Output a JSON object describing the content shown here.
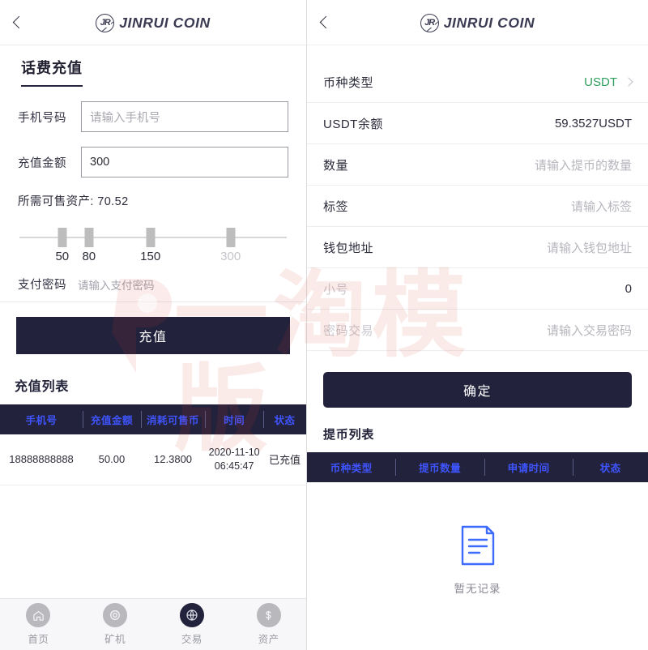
{
  "brand": {
    "logo_initials": "JR",
    "logo_text": "JINRUI COIN"
  },
  "watermark": {
    "text": "一淘模版"
  },
  "colors": {
    "primary_dark": "#23223c",
    "table_header_text": "#3e54ff",
    "accent_green": "#2f9e5f",
    "empty_icon": "#3d6bff"
  },
  "left_panel": {
    "back_icon": "chevron-left-icon",
    "tab_title": "话费充值",
    "fields": [
      {
        "label": "手机号码",
        "value": "",
        "placeholder": "请输入手机号"
      },
      {
        "label": "充值金额",
        "value": "300",
        "placeholder": ""
      }
    ],
    "required_assets_note": "所需可售资产: 70.52",
    "slider": {
      "options": [
        {
          "label": "50",
          "pos": 16,
          "selected": true
        },
        {
          "label": "80",
          "pos": 26,
          "selected": true
        },
        {
          "label": "150",
          "pos": 49,
          "selected": true
        },
        {
          "label": "300",
          "pos": 79,
          "selected": false
        }
      ]
    },
    "pay_password": {
      "label": "支付密码",
      "placeholder": "请输入支付密码"
    },
    "submit_label": "充值",
    "list_title": "充值列表",
    "table": {
      "columns": [
        "手机号",
        "充值金额",
        "消耗可售币",
        "时间",
        "状态"
      ],
      "rows": [
        {
          "phone": "18888888888",
          "amount": "50.00",
          "consumed": "12.3800",
          "date": "2020-11-10",
          "time": "06:45:47",
          "status": "已充值"
        }
      ]
    },
    "tabbar": [
      {
        "label": "首页",
        "icon": "home-icon",
        "glyph": "⌂",
        "active": false
      },
      {
        "label": "矿机",
        "icon": "miner-icon",
        "glyph": "◎",
        "active": false
      },
      {
        "label": "交易",
        "icon": "trade-icon",
        "glyph": "🌐",
        "active": true
      },
      {
        "label": "资产",
        "icon": "assets-icon",
        "glyph": "$",
        "active": false
      }
    ]
  },
  "right_panel": {
    "back_icon": "chevron-left-icon",
    "rows": [
      {
        "label": "币种类型",
        "value": "USDT",
        "style": "green",
        "chevron": true
      },
      {
        "label": "USDT余额",
        "value": "59.3527USDT",
        "style": "normal",
        "chevron": false
      },
      {
        "label": "数量",
        "value": "请输入提币的数量",
        "style": "placeholder",
        "chevron": false
      },
      {
        "label": "标签",
        "value": "请输入标签",
        "style": "placeholder",
        "chevron": false
      },
      {
        "label": "钱包地址",
        "value": "请输入钱包地址",
        "style": "placeholder",
        "chevron": false
      },
      {
        "label": "小号",
        "value": "0",
        "style": "normal",
        "chevron": false,
        "label_faded": true
      },
      {
        "label": "密码交易",
        "value": "请输入交易密码",
        "style": "placeholder",
        "chevron": false,
        "label_faded": true
      }
    ],
    "submit_label": "确定",
    "list_title": "提币列表",
    "table": {
      "columns": [
        "币种类型",
        "提币数量",
        "申请时间",
        "状态"
      ]
    },
    "empty": {
      "icon": "document-icon",
      "label": "暂无记录"
    }
  }
}
